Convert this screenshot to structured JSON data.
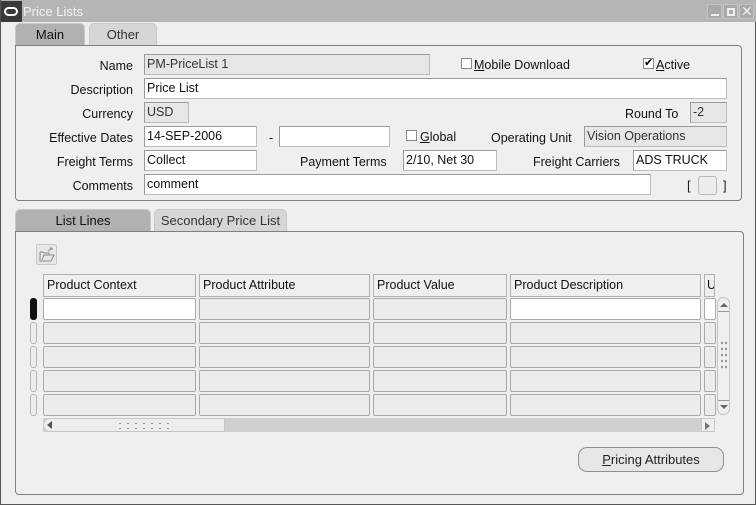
{
  "window": {
    "title": "Price Lists",
    "logo_icon": "oracle-logo-icon",
    "controls": [
      "minimize-icon",
      "maximize-icon",
      "close-icon"
    ]
  },
  "header_tabs": [
    {
      "label": "Main",
      "active": true
    },
    {
      "label": "Other",
      "active": false
    }
  ],
  "header": {
    "name": {
      "label": "Name",
      "value": "PM-PriceList 1"
    },
    "mobile_download": {
      "label": "Mobile Download",
      "checked": false
    },
    "active": {
      "label": "Active",
      "checked": true
    },
    "description": {
      "label": "Description",
      "value": "Price List"
    },
    "currency": {
      "label": "Currency",
      "value": "USD"
    },
    "round_to": {
      "label": "Round To",
      "value": "-2"
    },
    "effective_dates": {
      "label": "Effective Dates",
      "from": "14-SEP-2006",
      "separator": "-",
      "to": ""
    },
    "global": {
      "label": "Global",
      "checked": false
    },
    "operating_unit": {
      "label": "Operating Unit",
      "value": "Vision Operations"
    },
    "freight_terms": {
      "label": "Freight Terms",
      "value": "Collect"
    },
    "payment_terms": {
      "label": "Payment Terms",
      "value": "2/10, Net 30"
    },
    "freight_carriers": {
      "label": "Freight Carriers",
      "value": "ADS TRUCK"
    },
    "comments": {
      "label": "Comments",
      "value": "comment"
    },
    "dff": {
      "open": "[",
      "close": "]"
    }
  },
  "lines_tabs": [
    {
      "label": "List Lines",
      "active": true
    },
    {
      "label": "Secondary Price List",
      "active": false
    }
  ],
  "lines": {
    "toolbar_icon": "open-folder-icon",
    "columns": [
      "Product Context",
      "Product Attribute",
      "Product Value",
      "Product Description",
      "U"
    ],
    "rows": [
      [
        "",
        "",
        "",
        "",
        ""
      ],
      [
        "",
        "",
        "",
        "",
        ""
      ],
      [
        "",
        "",
        "",
        "",
        ""
      ],
      [
        "",
        "",
        "",
        "",
        ""
      ],
      [
        "",
        "",
        "",
        "",
        ""
      ]
    ],
    "current_row": 1
  },
  "buttons": {
    "pricing_attributes": "Pricing Attributes"
  }
}
